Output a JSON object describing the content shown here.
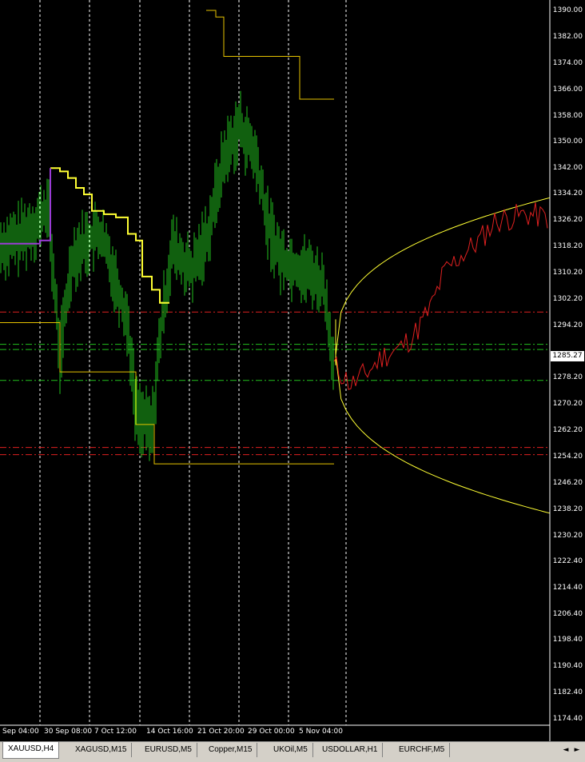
{
  "chart": {
    "current_price": "1285.27",
    "price_ticks": [
      "1390.00",
      "1382.00",
      "1374.00",
      "1366.00",
      "1358.00",
      "1350.00",
      "1342.00",
      "1334.20",
      "1326.20",
      "1318.20",
      "1310.20",
      "1302.20",
      "1294.20",
      "1278.20",
      "1270.20",
      "1262.20",
      "1254.20",
      "1246.20",
      "1238.20",
      "1230.20",
      "1222.40",
      "1214.40",
      "1206.40",
      "1198.40",
      "1190.40",
      "1182.40",
      "1174.40"
    ],
    "time_ticks": [
      "Sep 04:00",
      "30 Sep 08:00",
      "7 Oct 12:00",
      "14 Oct 16:00",
      "21 Oct 20:00",
      "29 Oct 00:00",
      "5 Nov 04:00"
    ],
    "colors": {
      "bars": "#22c11e",
      "upper_band": "#ffff33",
      "indicator_line": "#9b3bd6",
      "forecast": "#e02020",
      "envelope": "#ffff33",
      "level_red": "#e02020",
      "level_green": "#22c11e",
      "background": "#000000"
    }
  },
  "tabs": [
    {
      "label": "XAUUSD,H4",
      "active": true
    },
    {
      "label": "XAGUSD,M15",
      "active": false
    },
    {
      "label": "EURUSD,M5",
      "active": false
    },
    {
      "label": "Copper,M15",
      "active": false
    },
    {
      "label": "UKOil,M5",
      "active": false
    },
    {
      "label": "USDOLLAR,H1",
      "active": false
    },
    {
      "label": "EURCHF,M5",
      "active": false
    }
  ],
  "nav": {
    "left": "◄",
    "right": "►"
  }
}
